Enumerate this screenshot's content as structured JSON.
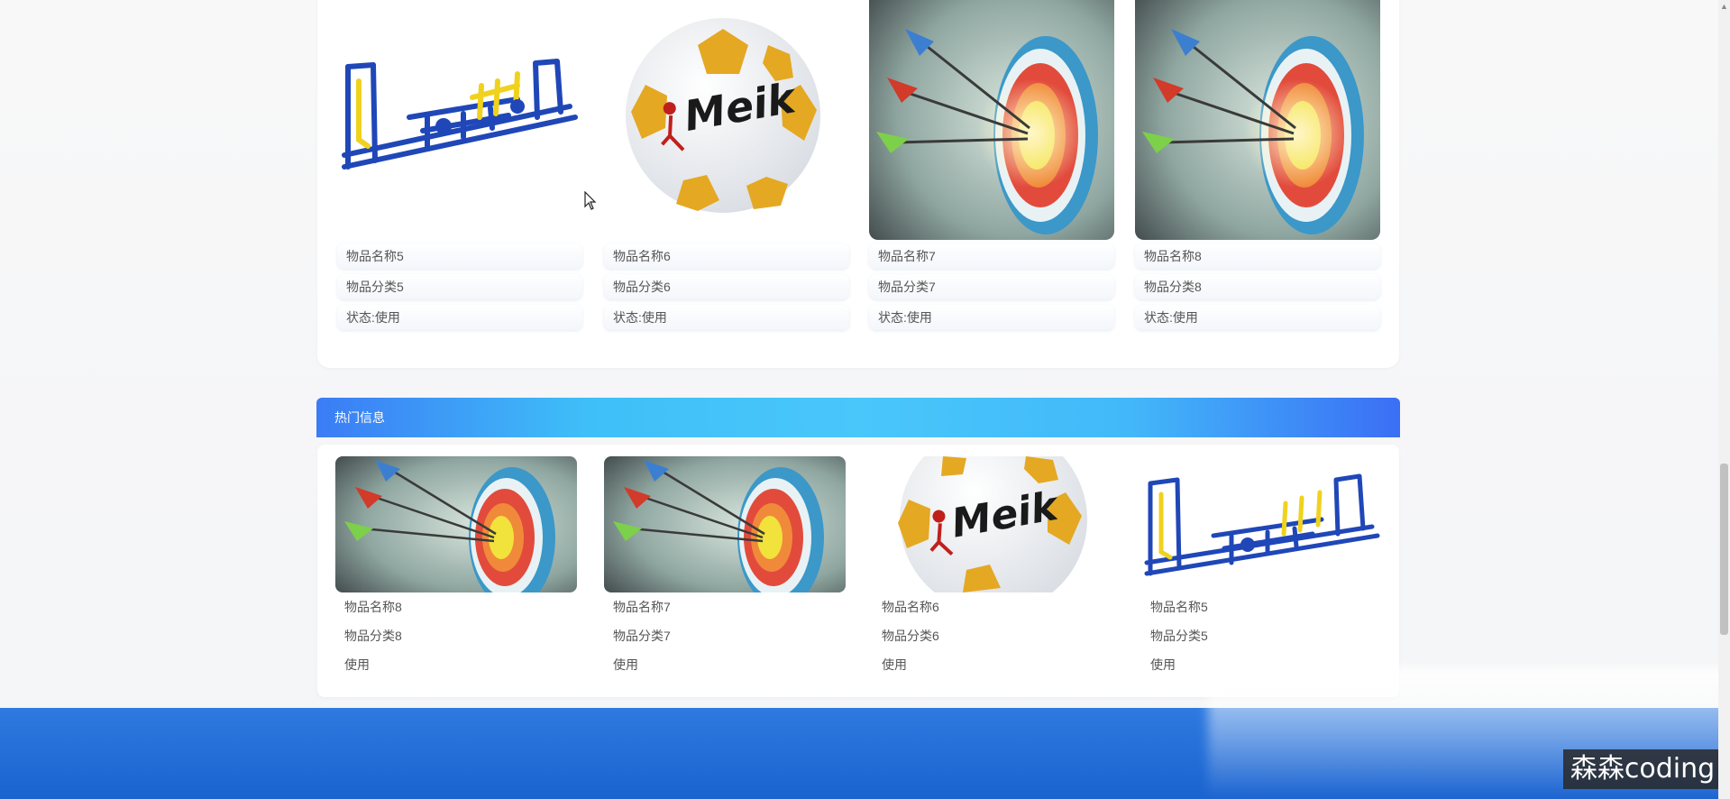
{
  "top_items": [
    {
      "name": "物品名称5",
      "category": "物品分类5",
      "status": "状态:使用",
      "image": "fitness-equipment"
    },
    {
      "name": "物品名称6",
      "category": "物品分类6",
      "status": "状态:使用",
      "image": "soccer-ball"
    },
    {
      "name": "物品名称7",
      "category": "物品分类7",
      "status": "状态:使用",
      "image": "archery-target"
    },
    {
      "name": "物品名称8",
      "category": "物品分类8",
      "status": "状态:使用",
      "image": "archery-target"
    }
  ],
  "hot": {
    "title": "热门信息",
    "items": [
      {
        "name": "物品名称8",
        "category": "物品分类8",
        "status": "使用",
        "image": "archery-target"
      },
      {
        "name": "物品名称7",
        "category": "物品分类7",
        "status": "使用",
        "image": "archery-target"
      },
      {
        "name": "物品名称6",
        "category": "物品分类6",
        "status": "使用",
        "image": "soccer-ball"
      },
      {
        "name": "物品名称5",
        "category": "物品分类5",
        "status": "使用",
        "image": "fitness-equipment"
      }
    ]
  },
  "ball_brand": "Meik",
  "watermark": "森森coding",
  "colors": {
    "header_blue": "#3b7cf5",
    "header_cyan": "#49c7fb",
    "footer_blue": "#1a63d0"
  }
}
